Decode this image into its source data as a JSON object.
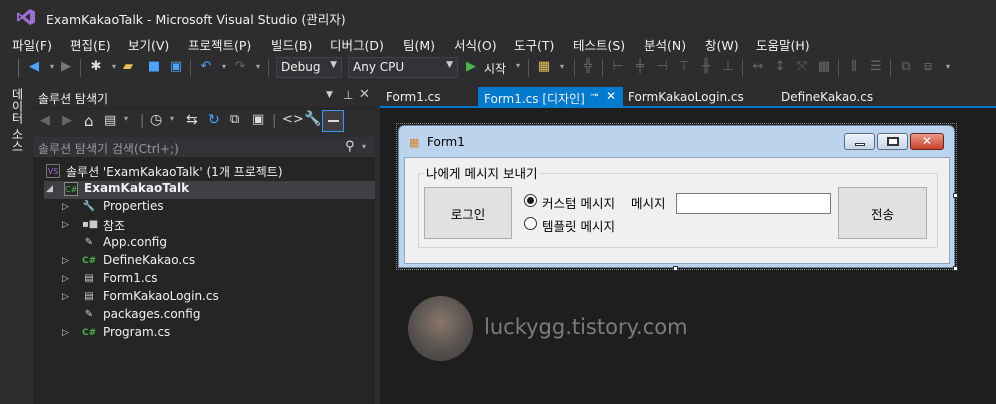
{
  "window": {
    "title": "ExamKakaoTalk - Microsoft Visual Studio  (관리자)"
  },
  "menu": [
    "파일(F)",
    "편집(E)",
    "보기(V)",
    "프로젝트(P)",
    "빌드(B)",
    "디버그(D)",
    "팀(M)",
    "서식(O)",
    "도구(T)",
    "테스트(S)",
    "분석(N)",
    "창(W)",
    "도움말(H)"
  ],
  "toolbar": {
    "config": "Debug",
    "platform": "Any CPU",
    "start_label": "시작"
  },
  "side_tab": {
    "label": "데이터 소스"
  },
  "solution_explorer": {
    "title": "솔루션 탐색기",
    "search_placeholder": "솔루션 탐색기 검색(Ctrl+;)",
    "solution": "솔루션 'ExamKakaoTalk' (1개 프로젝트)",
    "project": "ExamKakaoTalk",
    "items": [
      "Properties",
      "참조",
      "App.config",
      "DefineKakao.cs",
      "Form1.cs",
      "FormKakaoLogin.cs",
      "packages.config",
      "Program.cs"
    ]
  },
  "tabs": [
    "Form1.cs",
    "Form1.cs [디자인]",
    "FormKakaoLogin.cs",
    "DefineKakao.cs"
  ],
  "form": {
    "title": "Form1",
    "group_label": "나에게 메시지 보내기",
    "login_button": "로그인",
    "radio_custom": "커스텀 메시지",
    "radio_template": "템플릿 메시지",
    "message_label": "메시지",
    "message_value": "",
    "send_button": "전송"
  },
  "watermark": "luckygg.tistory.com",
  "colors": {
    "accent": "#007acc",
    "ide_bg": "#2d2d30",
    "panel_bg": "#252526",
    "designer_bg": "#1e1e1e",
    "close_red": "#c75050"
  }
}
